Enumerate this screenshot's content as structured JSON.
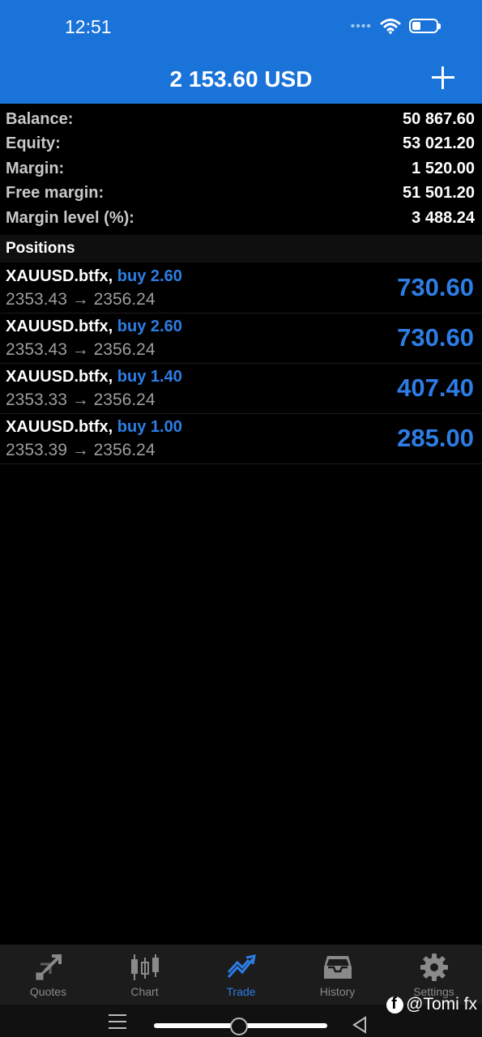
{
  "status_bar": {
    "time": "12:51",
    "icons": [
      "signal-dots-icon",
      "wifi-icon",
      "battery-icon"
    ]
  },
  "header": {
    "title": "2 153.60 USD",
    "add_icon": "plus-icon"
  },
  "summary": [
    {
      "label": "Balance:",
      "value": "50 867.60"
    },
    {
      "label": "Equity:",
      "value": "53 021.20"
    },
    {
      "label": "Margin:",
      "value": "1 520.00"
    },
    {
      "label": "Free margin:",
      "value": "51 501.20"
    },
    {
      "label": "Margin level (%):",
      "value": "3 488.24"
    }
  ],
  "positions": {
    "heading": "Positions",
    "items": [
      {
        "symbol": "XAUUSD.btfx,",
        "side": "buy 2.60",
        "open": "2353.43",
        "arrow": "→",
        "current": "2356.24",
        "profit": "730.60"
      },
      {
        "symbol": "XAUUSD.btfx,",
        "side": "buy 2.60",
        "open": "2353.43",
        "arrow": "→",
        "current": "2356.24",
        "profit": "730.60"
      },
      {
        "symbol": "XAUUSD.btfx,",
        "side": "buy 1.40",
        "open": "2353.33",
        "arrow": "→",
        "current": "2356.24",
        "profit": "407.40"
      },
      {
        "symbol": "XAUUSD.btfx,",
        "side": "buy 1.00",
        "open": "2353.39",
        "arrow": "→",
        "current": "2356.24",
        "profit": "285.00"
      }
    ]
  },
  "tabs": [
    {
      "label": "Quotes",
      "icon": "quotes-icon",
      "active": false
    },
    {
      "label": "Chart",
      "icon": "candlestick-icon",
      "active": false
    },
    {
      "label": "Trade",
      "icon": "trade-icon",
      "active": true
    },
    {
      "label": "History",
      "icon": "inbox-icon",
      "active": false
    },
    {
      "label": "Settings",
      "icon": "gear-icon",
      "active": false
    }
  ],
  "watermark": {
    "text": "@Tomi fx",
    "icon": "facebook-icon"
  },
  "colors": {
    "header_bg": "#1a73d9",
    "accent": "#2c7ee6",
    "background": "#000000",
    "tabbar_bg": "#1c1c1c"
  }
}
